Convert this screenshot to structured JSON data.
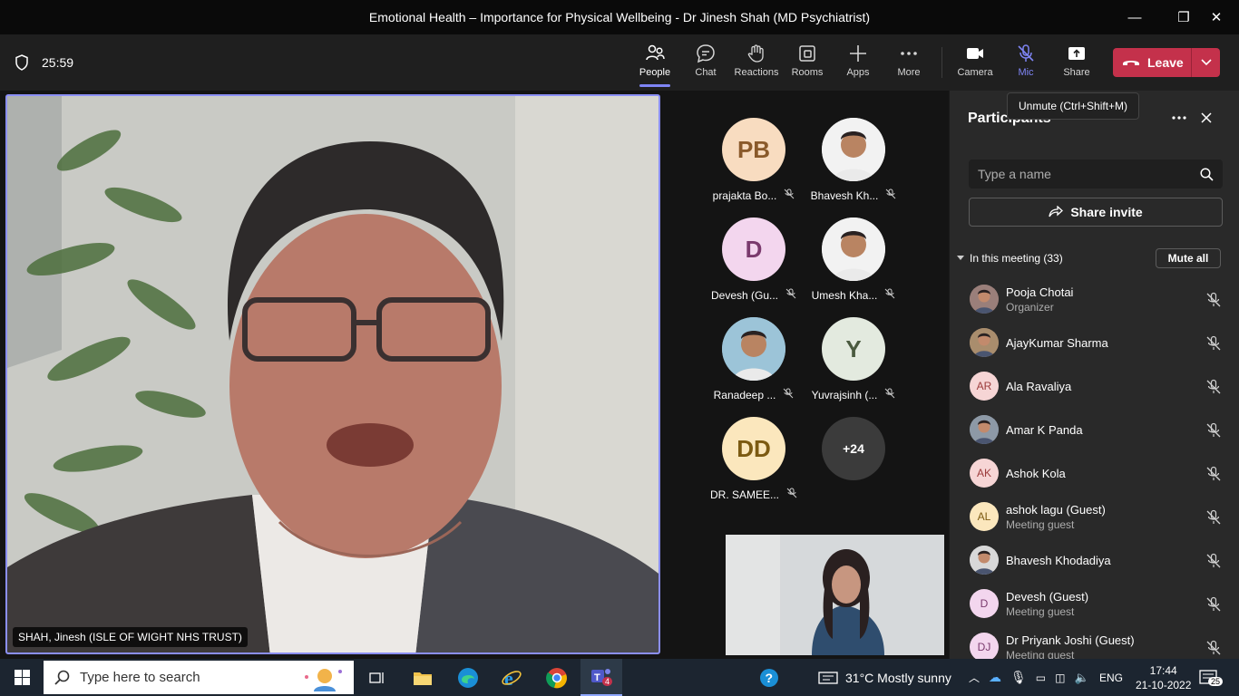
{
  "window": {
    "title": "Emotional Health – Importance for Physical Wellbeing - Dr Jinesh Shah (MD Psychiatrist)"
  },
  "toolbar": {
    "timer": "25:59",
    "people": "People",
    "chat": "Chat",
    "reactions": "Reactions",
    "rooms": "Rooms",
    "apps": "Apps",
    "more": "More",
    "camera": "Camera",
    "mic": "Mic",
    "share": "Share",
    "leave": "Leave"
  },
  "tooltip": "Unmute (Ctrl+Shift+M)",
  "main_video": {
    "name": "SHAH, Jinesh (ISLE OF WIGHT NHS TRUST)"
  },
  "tiles": [
    {
      "initials": "PB",
      "name": "prajakta Bo...",
      "color": "#f8dcc0",
      "text": "#8a5a2b",
      "photo": false
    },
    {
      "initials": "",
      "name": "Bhavesh Kh...",
      "color": "#f2f2f2",
      "text": "#333",
      "photo": true
    },
    {
      "initials": "D",
      "name": "Devesh (Gu...",
      "color": "#f3d6ee",
      "text": "#7a3a6d",
      "photo": false
    },
    {
      "initials": "",
      "name": "Umesh Kha...",
      "color": "#f2f2f2",
      "text": "#333",
      "photo": true
    },
    {
      "initials": "",
      "name": "Ranadeep ...",
      "color": "#9cc4d8",
      "text": "#333",
      "photo": true
    },
    {
      "initials": "Y",
      "name": "Yuvrajsinh (...",
      "color": "#e3eadf",
      "text": "#4a5a3f",
      "photo": false
    },
    {
      "initials": "DD",
      "name": "DR. SAMEE...",
      "color": "#fbe7bd",
      "text": "#7c5a12",
      "photo": false
    },
    {
      "initials": "+24",
      "name": "",
      "color": "#3b3b3b",
      "text": "#fff",
      "photo": false
    }
  ],
  "panel": {
    "title": "Participants",
    "search_placeholder": "Type a name",
    "share_invite": "Share invite",
    "in_meeting": "In this meeting (33)",
    "mute_all": "Mute all",
    "participants": [
      {
        "initials": "",
        "name": "Pooja Chotai",
        "sub": "Organizer",
        "color": "#9a7f7a",
        "photo": true
      },
      {
        "initials": "",
        "name": "AjayKumar Sharma",
        "sub": "",
        "color": "#a98d6d",
        "photo": true
      },
      {
        "initials": "AR",
        "name": "Ala Ravaliya",
        "sub": "",
        "color": "#f6d5d5",
        "photo": false,
        "text": "#9c3b3b"
      },
      {
        "initials": "",
        "name": "Amar K Panda",
        "sub": "",
        "color": "#8d99a6",
        "photo": true
      },
      {
        "initials": "AK",
        "name": "Ashok Kola",
        "sub": "",
        "color": "#f6d5d5",
        "photo": false,
        "text": "#9c3b3b"
      },
      {
        "initials": "AL",
        "name": "ashok lagu (Guest)",
        "sub": "Meeting guest",
        "color": "#fbe7bd",
        "photo": false,
        "text": "#7c5a12"
      },
      {
        "initials": "",
        "name": "Bhavesh Khodadiya",
        "sub": "",
        "color": "#d8d8d8",
        "photo": true
      },
      {
        "initials": "D",
        "name": "Devesh (Guest)",
        "sub": "Meeting guest",
        "color": "#f3d6ee",
        "photo": false,
        "text": "#7a3a6d"
      },
      {
        "initials": "DJ",
        "name": "Dr Priyank Joshi (Guest)",
        "sub": "Meeting guest",
        "color": "#f3d6ee",
        "photo": false,
        "text": "#7a3a6d"
      }
    ]
  },
  "taskbar": {
    "search_placeholder": "Type here to search",
    "weather": "31°C  Mostly sunny",
    "lang": "ENG",
    "time": "17:44",
    "date": "21-10-2022",
    "notif_count": "25",
    "teams_badge": "4"
  }
}
